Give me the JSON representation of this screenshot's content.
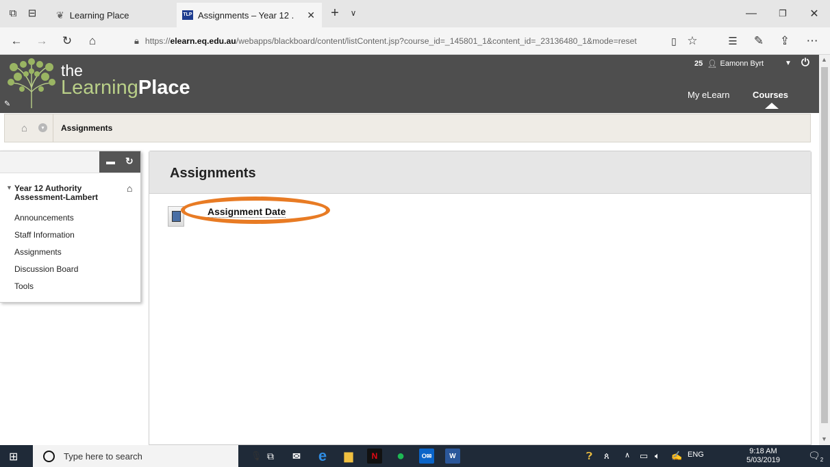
{
  "browser": {
    "tabs": [
      {
        "title": "Learning Place"
      },
      {
        "title": "Assignments – Year 12 ."
      }
    ],
    "favicon_text": "TLP",
    "address_prefix": "https://",
    "address_host": "elearn.eq.edu.au",
    "address_path": "/webapps/blackboard/content/listContent.jsp?course_id=_145801_1&content_id=_23136480_1&mode=reset"
  },
  "header": {
    "logo_the": "the",
    "logo_learning_initial": "L",
    "logo_learning_rest": "earning",
    "logo_place": "Place",
    "notification_count": "25",
    "user_name": "Eamonn Byrt",
    "nav_links": [
      "My eLearn",
      "Courses"
    ]
  },
  "breadcrumb": {
    "label": "Assignments"
  },
  "course_menu": {
    "course_title": "Year 12 Authority Assessment-Lambert",
    "items": [
      "Announcements",
      "Staff Information",
      "Assignments",
      "Discussion Board",
      "Tools"
    ]
  },
  "content": {
    "title": "Assignments",
    "item_link": "Assignment Date",
    "highlight_color": "#e87b24"
  },
  "taskbar": {
    "search_placeholder": "Type here to search",
    "language": "ENG",
    "time": "9:18 AM",
    "date": "5/03/2019",
    "notification_badge": "2"
  }
}
